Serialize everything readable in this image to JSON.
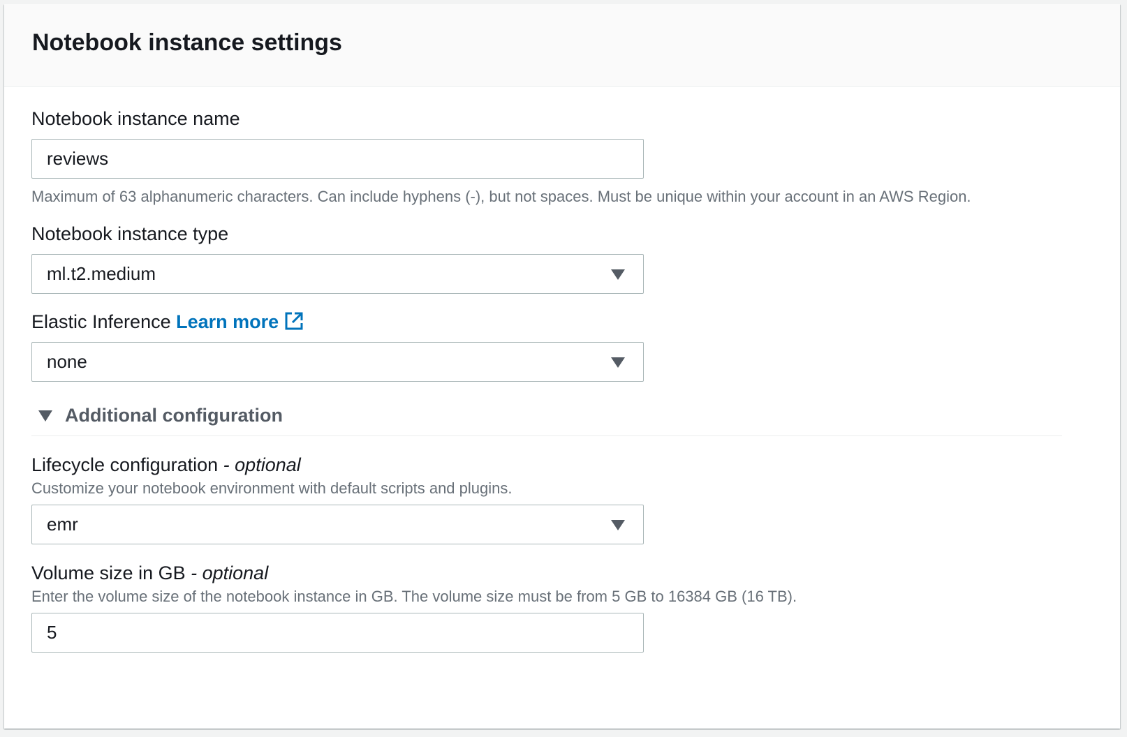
{
  "panel": {
    "title": "Notebook instance settings"
  },
  "fields": {
    "name": {
      "label": "Notebook instance name",
      "value": "reviews",
      "hint": "Maximum of 63 alphanumeric characters. Can include hyphens (-), but not spaces. Must be unique within your account in an AWS Region."
    },
    "type": {
      "label": "Notebook instance type",
      "value": "ml.t2.medium"
    },
    "elastic": {
      "label": "Elastic Inference",
      "link": "Learn more",
      "value": "none"
    },
    "additional": {
      "label": "Additional configuration"
    },
    "lifecycle": {
      "label": "Lifecycle configuration",
      "optional": "- optional",
      "hint": "Customize your notebook environment with default scripts and plugins.",
      "value": "emr"
    },
    "volume": {
      "label": "Volume size in GB",
      "optional": "- optional",
      "hint": "Enter the volume size of the notebook instance in GB. The volume size must be from 5 GB to 16384 GB (16 TB).",
      "value": "5"
    }
  },
  "icons": {
    "external_link": "external-link-icon",
    "dropdown_caret": "caret-down-icon",
    "expander": "caret-down-icon"
  },
  "colors": {
    "link": "#0073bb",
    "text": "#16191f",
    "hint": "#687078",
    "border": "#aab7b8",
    "header_bg": "#fafafa"
  }
}
